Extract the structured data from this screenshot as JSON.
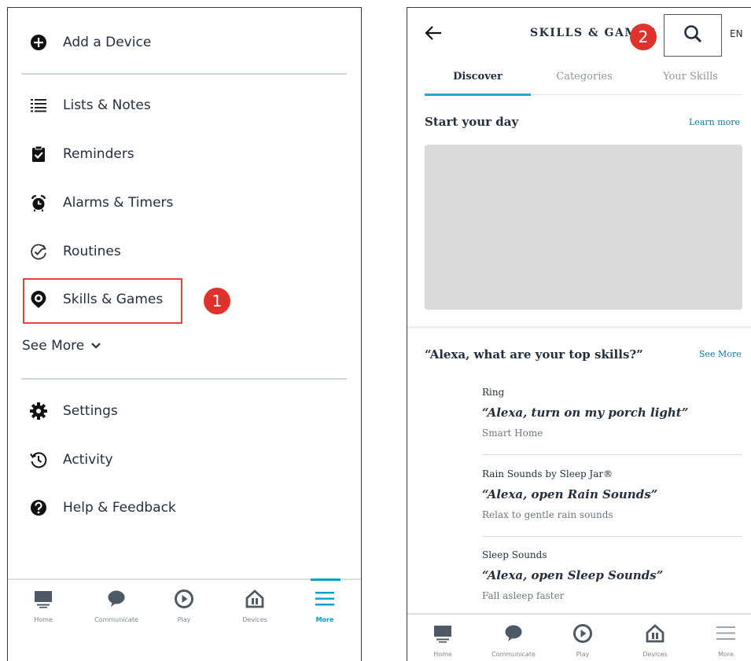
{
  "left": {
    "menu_top": [
      {
        "label": "Add a Device",
        "icon": "plus-circle-icon"
      }
    ],
    "menu_main": [
      {
        "label": "Lists & Notes",
        "icon": "list-icon"
      },
      {
        "label": "Reminders",
        "icon": "clipboard-check-icon"
      },
      {
        "label": "Alarms & Timers",
        "icon": "alarm-clock-icon"
      },
      {
        "label": "Routines",
        "icon": "routine-check-icon"
      },
      {
        "label": "Skills & Games",
        "icon": "skills-pin-icon"
      }
    ],
    "see_more": "See More",
    "menu_bottom": [
      {
        "label": "Settings",
        "icon": "gear-icon"
      },
      {
        "label": "Activity",
        "icon": "history-icon"
      },
      {
        "label": "Help & Feedback",
        "icon": "question-circle-icon"
      }
    ],
    "step_badge": "1",
    "nav": [
      "Home",
      "Communicate",
      "Play",
      "Devices",
      "More"
    ],
    "active_nav": "More"
  },
  "right": {
    "title": "SKILLS & GAMES",
    "lang": "EN",
    "step_badge": "2",
    "tabs": [
      "Discover",
      "Categories",
      "Your Skills"
    ],
    "active_tab": "Discover",
    "section1": {
      "title": "Start your day",
      "link": "Learn more"
    },
    "section2": {
      "title": "“Alexa, what are your top skills?”",
      "link": "See More"
    },
    "skills": [
      {
        "name": "Ring",
        "phrase": "“Alexa, turn on my porch light”",
        "category": "Smart Home"
      },
      {
        "name": "Rain Sounds by Sleep Jar®",
        "phrase": "“Alexa, open Rain Sounds”",
        "category": "Relax to gentle rain sounds"
      },
      {
        "name": "Sleep Sounds",
        "phrase": "“Alexa, open Sleep Sounds”",
        "category": "Fall asleep faster"
      }
    ],
    "nav": [
      "Home",
      "Communicate",
      "Play",
      "Devices",
      "More"
    ]
  },
  "colors": {
    "accent": "#00a0c8",
    "highlight": "#e0453a",
    "badge": "#e0322a",
    "text": "#232f3e"
  }
}
